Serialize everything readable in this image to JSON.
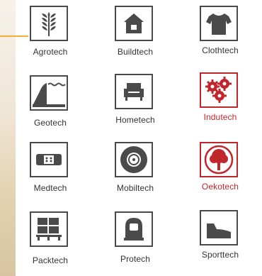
{
  "tiles": [
    {
      "label": "Agrotech",
      "icon": "wheat-icon"
    },
    {
      "label": "Buildtech",
      "icon": "house-icon"
    },
    {
      "label": "Clothtech",
      "icon": "tshirt-icon"
    },
    {
      "label": "Geotech",
      "icon": "slope-wave-icon"
    },
    {
      "label": "Hometech",
      "icon": "armchair-icon"
    },
    {
      "label": "Indutech",
      "icon": "gears-icon",
      "accent": "#c0272d"
    },
    {
      "label": "Medtech",
      "icon": "bandage-icon"
    },
    {
      "label": "Mobiltech",
      "icon": "wheel-icon"
    },
    {
      "label": "Oekotech",
      "icon": "tree-icon",
      "accent": "#c0272d"
    },
    {
      "label": "Packtech",
      "icon": "pallet-icon"
    },
    {
      "label": "Protech",
      "icon": "helmet-icon"
    },
    {
      "label": "Sporttech",
      "icon": "sneaker-icon"
    }
  ],
  "colors": {
    "dark": "#4a4a4a",
    "red": "#c0272d",
    "left_accent": "#f2b23a"
  }
}
